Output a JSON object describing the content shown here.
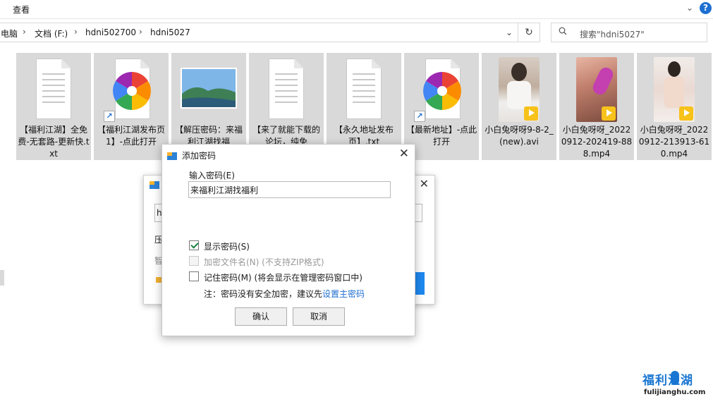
{
  "ribbon": {
    "view_menu": "查看"
  },
  "address": {
    "crumbs": [
      "电脑",
      "文档 (F:)",
      "hdni502700",
      "hdni5027"
    ]
  },
  "search": {
    "placeholder": "搜索\"hdni5027\""
  },
  "files": [
    {
      "name": "【福利江湖】全免费-无套路-更新快.txt",
      "icon": "text-file-icon"
    },
    {
      "name": "【福利江湖发布页1】-点此打开",
      "icon": "360-browser-icon"
    },
    {
      "name": "【解压密码：来福利江湖找福",
      "icon": "image-file-icon"
    },
    {
      "name": "【来了就能下载的论坛，纯免",
      "icon": "text-file-icon"
    },
    {
      "name": "【永久地址发布页】.txt",
      "icon": "text-file-icon"
    },
    {
      "name": "【最新地址】-点此打开",
      "icon": "360-browser-icon"
    },
    {
      "name": "小白兔呀呀9-8-2_(new).avi",
      "icon": "video-file-icon"
    },
    {
      "name": "小白兔呀呀_20220912-202419-888.mp4",
      "icon": "video-file-icon"
    },
    {
      "name": "小白兔呀呀_20220912-213913-610.mp4",
      "icon": "video-file-icon"
    }
  ],
  "back_dialog": {
    "field_value": "h",
    "line1": "压",
    "line2": "智"
  },
  "dialog": {
    "title": "添加密码",
    "password_label": "输入密码(E)",
    "password_value": "来福利江湖找福利",
    "show_password": "显示密码(S)",
    "encrypt_names": "加密文件名(N) (不支持ZIP格式)",
    "remember_password": "记住密码(M) (将会显示在管理密码窗口中)",
    "note": "注：密码没有安全加密，建议先",
    "note_link": "设置主密码",
    "ok": "确认",
    "cancel": "取消"
  },
  "watermark": {
    "text": "福利江湖",
    "url": "fulijianghu.com"
  },
  "colors": {
    "accent": "#1e6fd1",
    "selection": "#d9d9d9",
    "primary_button": "#1e88f0"
  }
}
